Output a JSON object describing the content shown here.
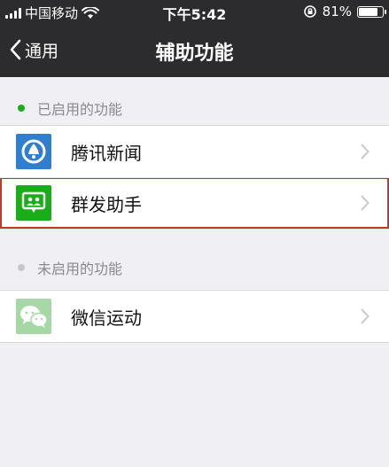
{
  "status_bar": {
    "carrier": "中国移动",
    "time": "下午5:42",
    "battery_percent": "81%",
    "battery_level": 0.81
  },
  "nav": {
    "back_label": "通用",
    "title": "辅助功能"
  },
  "sections": {
    "enabled": {
      "header": "已启用的功能",
      "dot_color": "#1aad19",
      "items": [
        {
          "label": "腾讯新闻",
          "icon": "tencent-news-icon",
          "icon_bg": "#2f7ecf"
        },
        {
          "label": "群发助手",
          "icon": "mass-send-assistant-icon",
          "icon_bg": "#1aad19"
        }
      ]
    },
    "disabled": {
      "header": "未启用的功能",
      "dot_color": "#c7c7cc",
      "items": [
        {
          "label": "微信运动",
          "icon": "wechat-sport-icon",
          "icon_bg": "#a5d8a5"
        }
      ]
    }
  },
  "colors": {
    "header_bg": "#2c2c2e",
    "page_bg": "#efeff4",
    "highlight_border": "#c0392b"
  }
}
